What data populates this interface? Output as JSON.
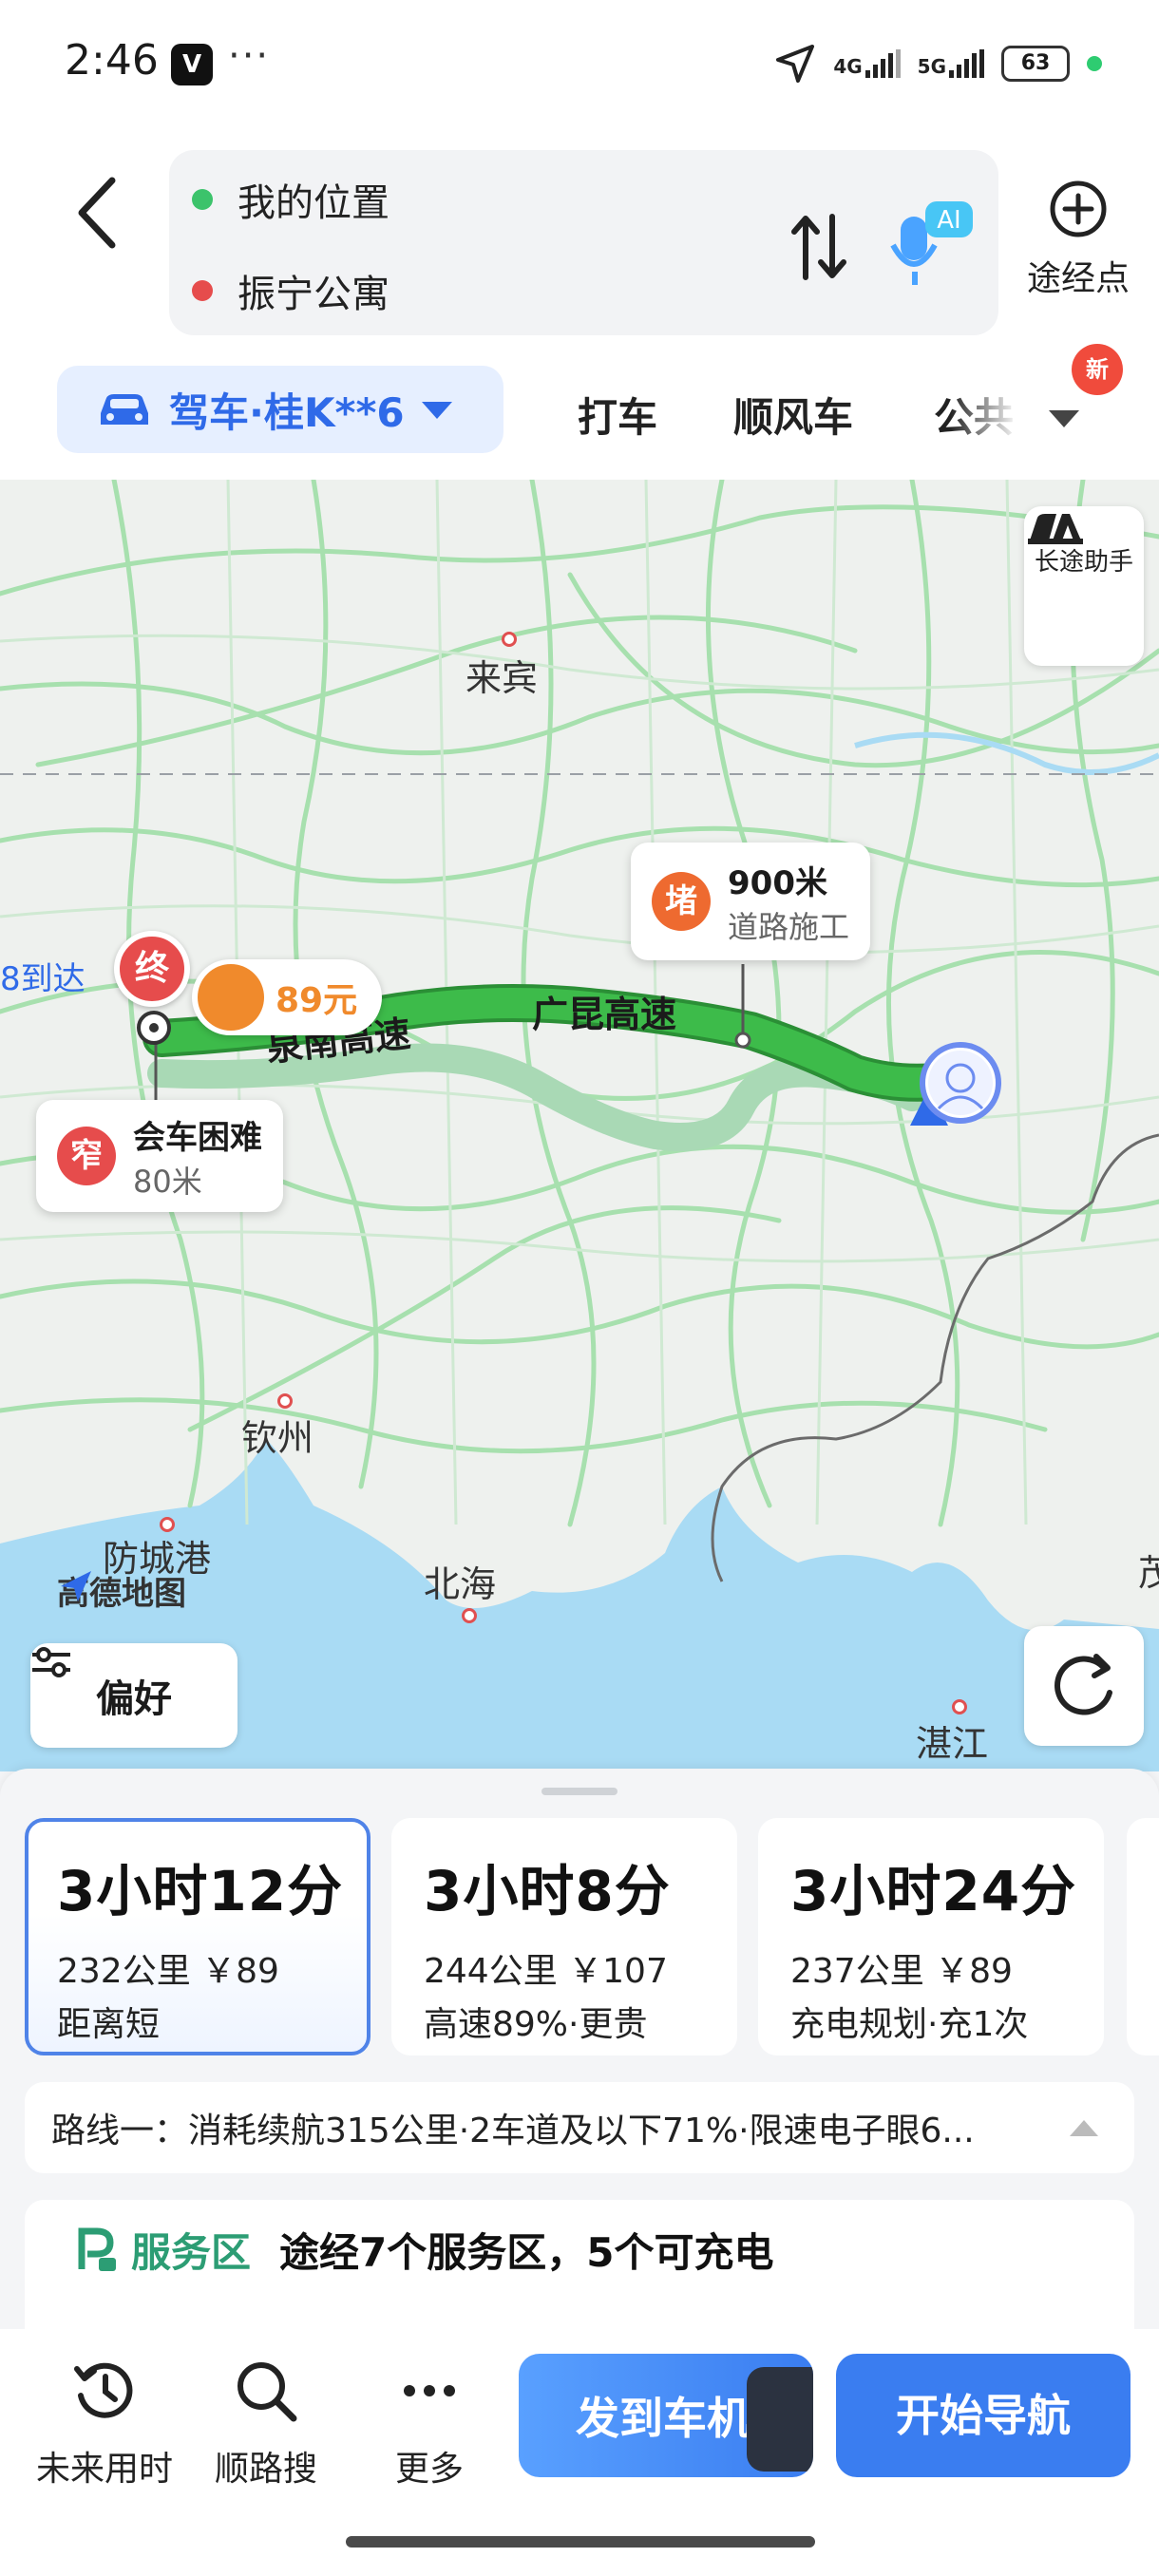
{
  "status_bar": {
    "time": "2:46",
    "app_icon_letter": "V",
    "overflow": "···",
    "network_4g": "4G",
    "network_5g": "5G",
    "battery": "63",
    "icons": [
      "location-arrow-icon",
      "signal-bars-icon",
      "battery-icon"
    ]
  },
  "search": {
    "origin": "我的位置",
    "destination": "振宁公寓",
    "origin_dot_color": "#3cc36b",
    "destination_dot_color": "#e64c4c",
    "ai_badge": "AI",
    "waypoint_label": "途经点"
  },
  "modes": {
    "drive_label": "驾车·桂K**6",
    "taxi_label": "打车",
    "carpool_label": "顺风车",
    "transit_label": "公共",
    "new_badge": "新",
    "accent": "#2f6ae8"
  },
  "map": {
    "cities": {
      "laibin": "来宾",
      "qinzhou": "钦州",
      "fangchenggang": "防城港",
      "beihai": "北海",
      "zhanjiang": "湛江",
      "edge_city": "茂"
    },
    "longtrip_label": "长途助手",
    "congestion": {
      "badge": "堵",
      "distance": "900米",
      "reason": "道路施工"
    },
    "narrow": {
      "badge": "窄",
      "title": "会车困难",
      "distance": "80米"
    },
    "end_marker": "终",
    "toll": "89元",
    "arrival_partial": "8到达",
    "road_labels": {
      "a": "泉南高速",
      "b": "广昆高速"
    },
    "logo": "高德地图",
    "preference_label": "偏好",
    "colors": {
      "route_main": "#3dbb4a",
      "route_alt": "#a9d9b5",
      "water": "#a9dbf4",
      "road": "#a7e0ae"
    }
  },
  "routes": [
    {
      "time": "3小时12分",
      "meta": "232公里  ￥89",
      "tag": "距离短",
      "selected": true
    },
    {
      "time": "3小时8分",
      "meta": "244公里  ￥107",
      "tag": "高速89%·更贵",
      "selected": false
    },
    {
      "time": "3小时24分",
      "meta": "237公里  ￥89",
      "tag": "充电规划·充1次",
      "selected": false
    }
  ],
  "route_summary": "路线一：消耗续航315公里·2车道及以下71%·限速电子眼6...",
  "service": {
    "title": "服务区",
    "description": "途经7个服务区，5个可充电"
  },
  "actions": {
    "future_time": "未来用时",
    "along_search": "顺路搜",
    "more": "更多",
    "send_to_car": "发到车机",
    "start_navigation": "开始导航"
  }
}
